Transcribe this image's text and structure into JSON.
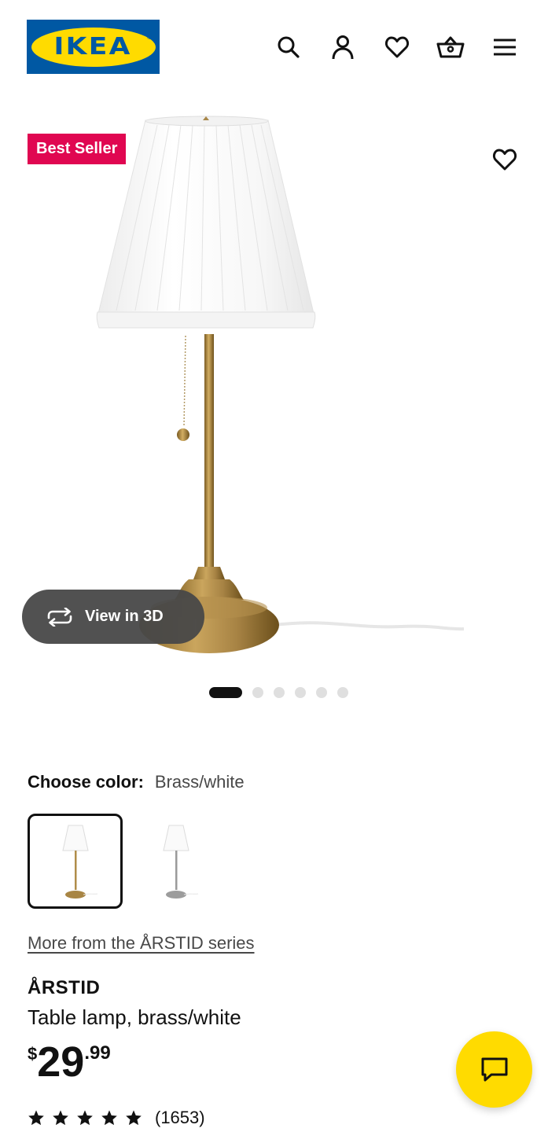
{
  "header": {
    "logo_text": "IKEA",
    "icons": [
      "search-icon",
      "account-icon",
      "heart-icon",
      "basket-icon",
      "menu-icon"
    ]
  },
  "gallery": {
    "badge": "Best Seller",
    "view_3d_label": "View in 3D",
    "slide_count": 6,
    "active_slide": 1
  },
  "color": {
    "label": "Choose color:",
    "value": "Brass/white",
    "options": [
      "Brass/white",
      "Nickel-plated/white"
    ],
    "selected_index": 0
  },
  "series_link": "More from the ÅRSTID series",
  "product": {
    "name": "ÅRSTID",
    "description": "Table lamp, brass/white",
    "price_currency": "$",
    "price_int": "29",
    "price_dec": ".99",
    "rating_stars": 5,
    "rating_count": "(1653)"
  },
  "colors": {
    "ikea_blue": "#0058a3",
    "ikea_yellow": "#ffdb00",
    "badge_red": "#e00751"
  }
}
